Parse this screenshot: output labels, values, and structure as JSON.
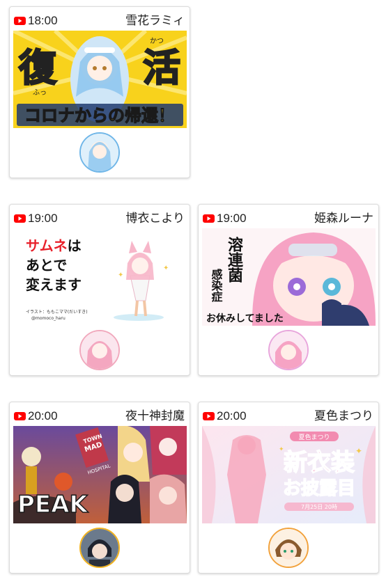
{
  "cards": [
    {
      "time": "18:00",
      "name": "雪花ラミィ",
      "thumb": {
        "big_left": "復",
        "big_right": "活",
        "ruby_left": "ふっ",
        "ruby_right": "かつ",
        "banner": "コロナからの帰還！"
      }
    },
    {
      "time": "19:00",
      "name": "博衣こより",
      "thumb": {
        "line1": "サムネは",
        "line2": "あとで",
        "line3": "変えます",
        "credit1": "イラスト：ももこママ(だいすき)",
        "credit2": "@momoco_haru"
      }
    },
    {
      "time": "19:00",
      "name": "姫森ルーナ",
      "thumb": {
        "col_big": "溶連菌",
        "col_small": "感染症",
        "bottom": "お休みしてました"
      }
    },
    {
      "time": "20:00",
      "name": "夜十神封魔",
      "thumb": {
        "title": "PEAK",
        "sign_top": "MAD",
        "sign_side": "TOWN",
        "sign_bottom": "HOSPITAL"
      }
    },
    {
      "time": "20:00",
      "name": "夏色まつり",
      "thumb": {
        "top": "夏色まつり",
        "big": "新衣装",
        "sub": "お披露目",
        "date": "7月25日 20時"
      }
    }
  ],
  "colors": {
    "youtube_red": "#ff0000",
    "text": "#222222",
    "card_border": "#dcdcdc"
  },
  "icons": {
    "live_platform": "youtube-icon"
  }
}
